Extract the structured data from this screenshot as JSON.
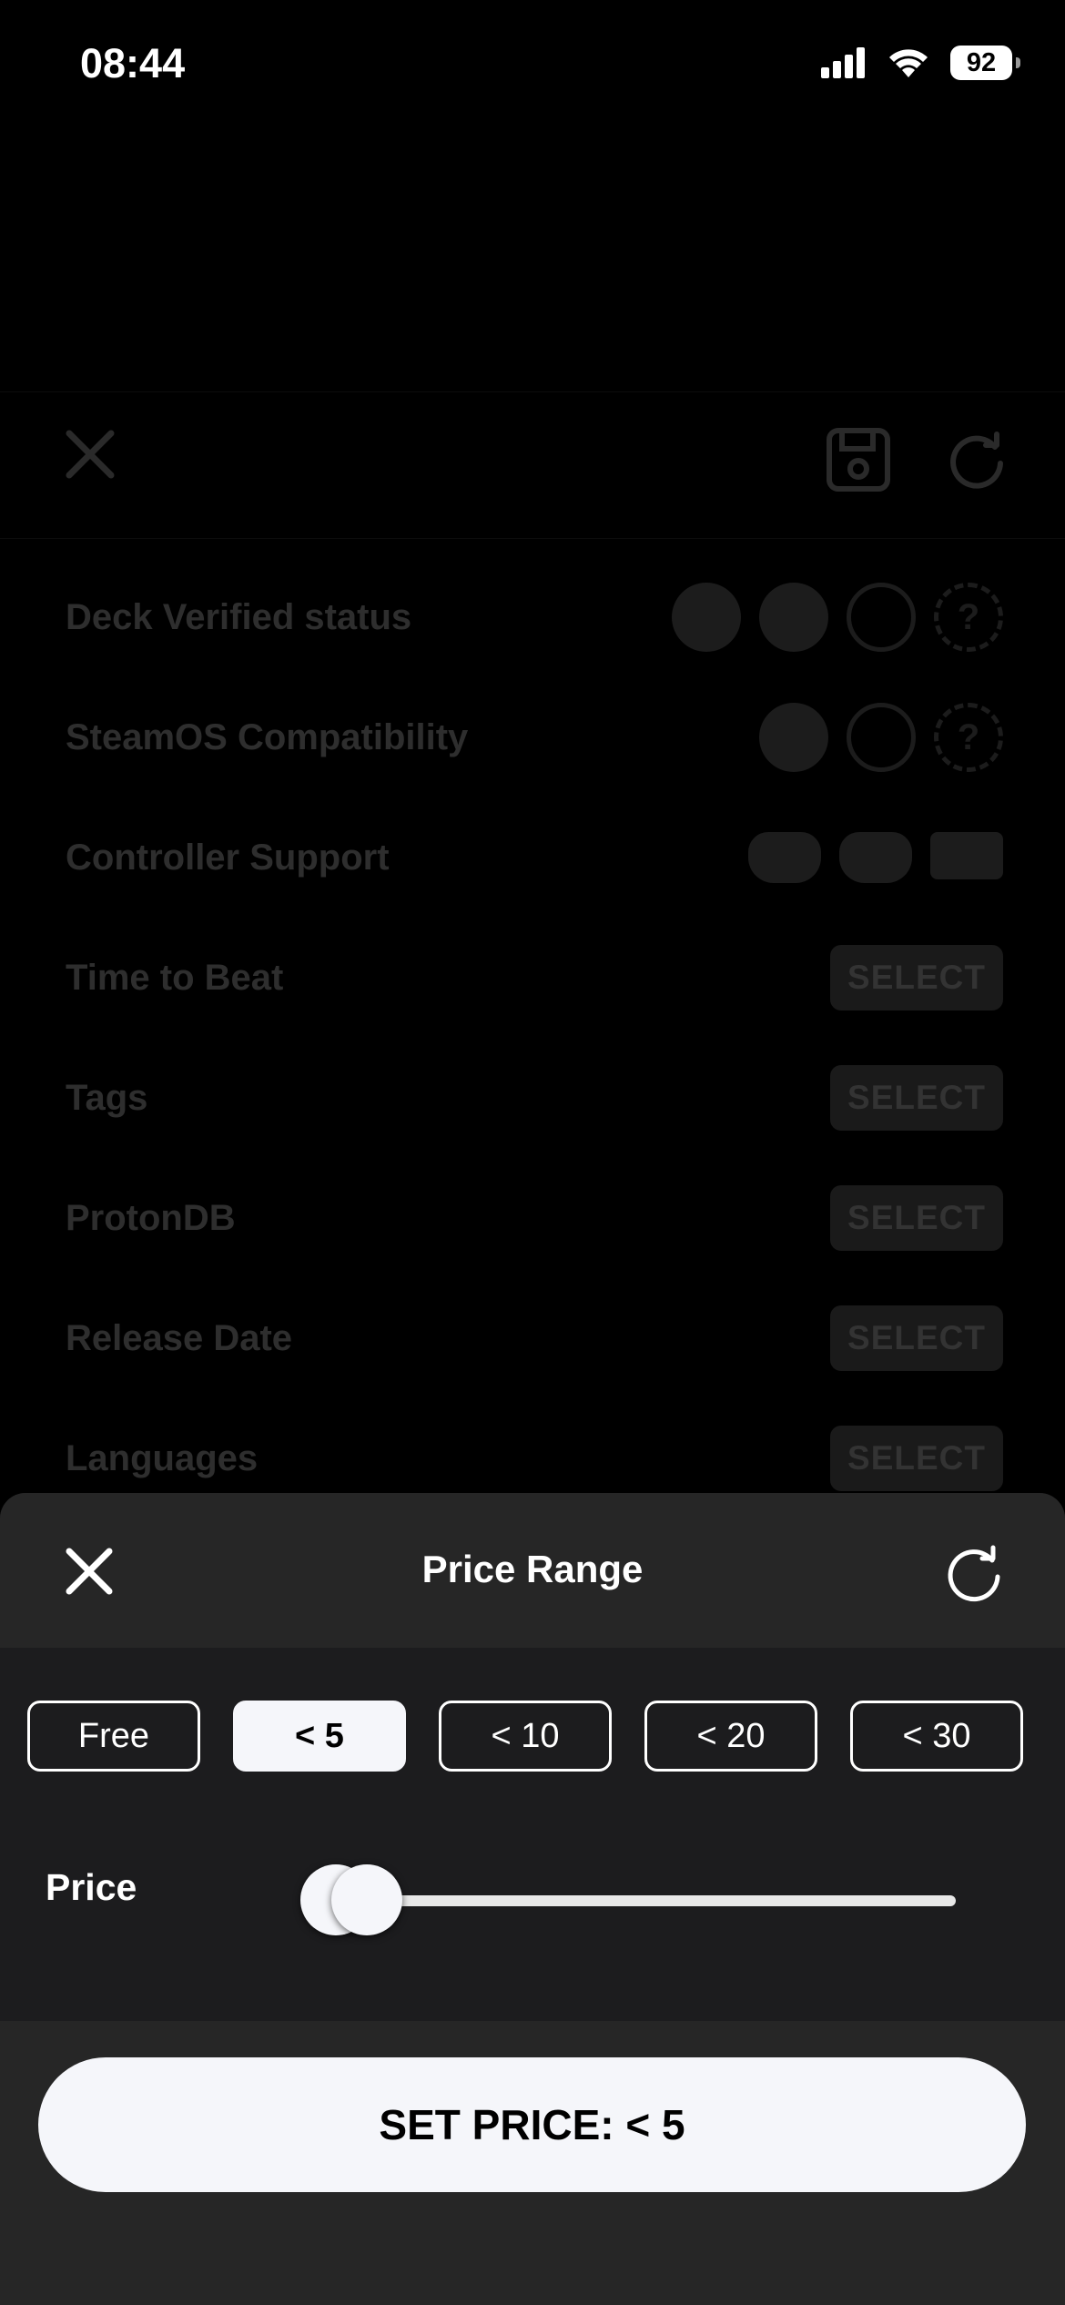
{
  "status_bar": {
    "time": "08:44",
    "battery": "92"
  },
  "background": {
    "rows": [
      {
        "label": "Deck Verified status"
      },
      {
        "label": "SteamOS Compatibility"
      },
      {
        "label": "Controller Support"
      },
      {
        "label": "Time to Beat",
        "button": "SELECT"
      },
      {
        "label": "Tags",
        "button": "SELECT"
      },
      {
        "label": "ProtonDB",
        "button": "SELECT"
      },
      {
        "label": "Release Date",
        "button": "SELECT"
      },
      {
        "label": "Languages",
        "button": "SELECT"
      }
    ]
  },
  "sheet": {
    "title": "Price Range",
    "chips": [
      {
        "label": "Free",
        "active": false
      },
      {
        "label": "< 5",
        "active": true
      },
      {
        "label": "< 10",
        "active": false
      },
      {
        "label": "< 20",
        "active": false
      },
      {
        "label": "< 30",
        "active": false
      }
    ],
    "price_label": "Price",
    "slider": {
      "min_fraction": 0.0,
      "max_fraction": 0.05
    },
    "set_button": "SET PRICE: < 5"
  }
}
